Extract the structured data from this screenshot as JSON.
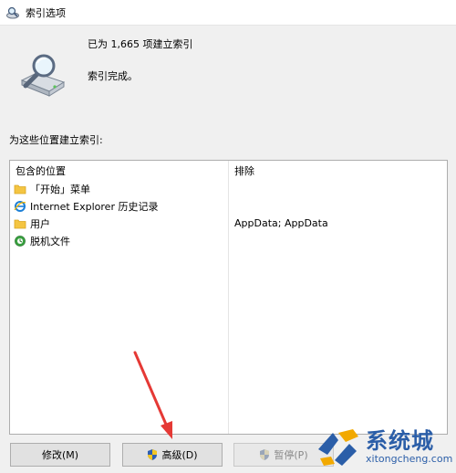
{
  "window": {
    "title": "索引选项"
  },
  "status": {
    "count_text": "已为 1,665 项建立索引",
    "message": "索引完成。"
  },
  "locations": {
    "label": "为这些位置建立索引:",
    "columns": {
      "included": "包含的位置",
      "excluded": "排除"
    },
    "rows": [
      {
        "name": "「开始」菜单",
        "icon": "folder-icon",
        "exclude": ""
      },
      {
        "name": "Internet Explorer 历史记录",
        "icon": "internet-explorer-icon",
        "exclude": ""
      },
      {
        "name": "用户",
        "icon": "folder-icon",
        "exclude": "AppData; AppData"
      },
      {
        "name": "脱机文件",
        "icon": "offline-files-icon",
        "exclude": ""
      }
    ]
  },
  "buttons": {
    "modify": "修改(M)",
    "advanced": "高级(D)",
    "pause": "暂停(P)"
  },
  "watermark": {
    "cn": "系统城",
    "en": "xitongcheng.com"
  },
  "colors": {
    "accent": "#2b5ea8",
    "arrow": "#e53935",
    "folder": "#f4c542"
  }
}
